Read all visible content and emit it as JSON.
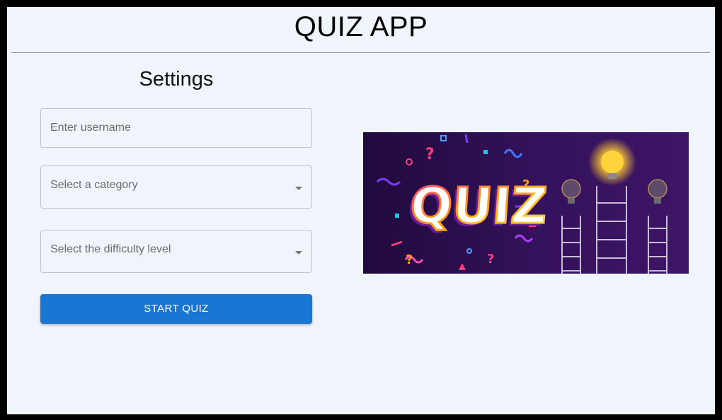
{
  "header": {
    "title": "QUIZ APP"
  },
  "settings": {
    "title": "Settings",
    "username_placeholder": "Enter username",
    "category_placeholder": "Select a category",
    "difficulty_placeholder": "Select the difficulty level",
    "start_button": "START QUIZ"
  },
  "banner": {
    "text": "QUIZ",
    "image": "quiz-banner-with-lightbulbs-and-ladders"
  },
  "colors": {
    "background": "#f0f4fb",
    "accent": "#1976d2",
    "banner_bg": "#2a0f4a",
    "bulb_glow": "#ffcf3a"
  }
}
